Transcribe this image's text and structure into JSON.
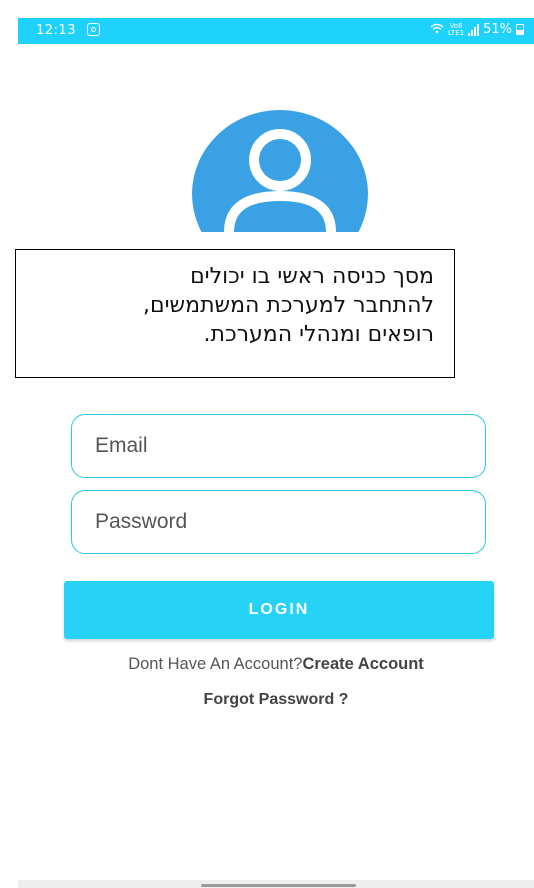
{
  "status_bar": {
    "time": "12:13",
    "battery": "51%",
    "network_label": "Vo8\nLTE1",
    "background_color": "#1fd2fb"
  },
  "avatar": {
    "icon": "user-avatar-icon",
    "color": "#3aa2e4"
  },
  "callout": {
    "lines": [
      "מסך כניסה ראשי בו יכולים",
      "להתחבר למערכת המשתמשים,",
      "רופאים ומנהלי המערכת."
    ]
  },
  "form": {
    "email_placeholder": "Email",
    "password_placeholder": "Password",
    "login_label": "LOGIN",
    "border_color": "#29c9e6",
    "button_color": "#27d2f7"
  },
  "links": {
    "no_account_text": "Dont Have An Account?",
    "create_account": "Create Account",
    "forgot_password": "Forgot Password ?"
  }
}
